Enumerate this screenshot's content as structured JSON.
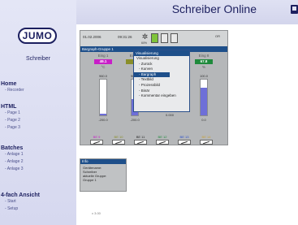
{
  "sidebar": {
    "logo": "JUMO",
    "title": "Schreiber",
    "groups": [
      {
        "heading": "Home",
        "items": [
          "Recorder"
        ]
      },
      {
        "heading": "HTML",
        "items": [
          "Page 1",
          "Page 2",
          "Page 3"
        ]
      },
      {
        "heading": "Batches",
        "items": [
          "Anlage 1",
          "Anlage 2",
          "Anlage 3"
        ]
      },
      {
        "heading": "4-fach Ansicht",
        "items": [
          "Start",
          "Setup"
        ]
      }
    ]
  },
  "header": {
    "title": "Schreiber Online",
    "icon": "window-icon"
  },
  "device": {
    "status": {
      "date": "01.02.2006",
      "time": "09:31:26",
      "pct": "60%",
      "icon_label": "OR"
    },
    "group_label": "Bargraph-Gruppe 1",
    "channels": [
      {
        "name": "Eing 1",
        "value": "49.1",
        "unit": "°C",
        "top": "960.0",
        "bottom": "-200.0",
        "percent": "5%",
        "fill": 0.05,
        "color": "#c81ec8"
      },
      {
        "name": "Eing 2",
        "value": "",
        "unit": "",
        "top": "960.0",
        "bottom": "-200.0",
        "percent": "",
        "fill": 0.45,
        "color": "#8a8f2a"
      },
      {
        "name": "Eing 5",
        "value": "",
        "unit": "",
        "top": "",
        "bottom": "0.000",
        "percent": "",
        "fill": 0.0,
        "color": "#888888"
      },
      {
        "name": "Eing 8",
        "value": "67.8",
        "unit": "%",
        "top": "100.0",
        "bottom": "0.0",
        "percent": "",
        "fill": 0.78,
        "color": "#1f8a3c"
      }
    ],
    "binary": [
      {
        "label": "BE 9",
        "color": "#c81ec8"
      },
      {
        "label": "BE 10",
        "color": "#8a8f2a"
      },
      {
        "label": "BE 11",
        "color": "#2a2a2a"
      },
      {
        "label": "BE 12",
        "color": "#1f8a3c"
      },
      {
        "label": "BE 13",
        "color": "#2a4fcc"
      },
      {
        "label": "BE 14",
        "color": "#c8a23c"
      }
    ]
  },
  "menu": {
    "header": "Visualisierung",
    "items": [
      {
        "label": "Visualisierung",
        "sub": false
      },
      {
        "label": "Zurück",
        "sub": true
      },
      {
        "label": "Kurven",
        "sub": true
      },
      {
        "label": "Bargraph",
        "sub": true,
        "selected": true
      },
      {
        "label": "Textbild",
        "sub": true
      },
      {
        "label": "Prozessbild",
        "sub": true
      },
      {
        "label": "Binär",
        "sub": true
      },
      {
        "label": "Kommentar eingeben",
        "sub": true
      }
    ]
  },
  "info_panel": {
    "header": "Info",
    "lines": [
      "Gerätename:",
      "Schreiber",
      "",
      "aktuelle Gruppe:",
      "Gruppe 1"
    ]
  },
  "version": "v 3.00",
  "colors": {
    "accent": "#1e4f8a",
    "brand": "#1c1f5f"
  }
}
